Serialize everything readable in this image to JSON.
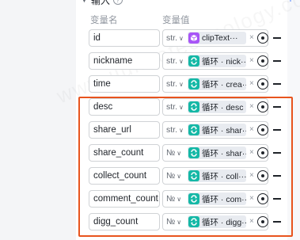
{
  "section": {
    "title": "输入",
    "help_glyph": "?",
    "add_glyph": "+"
  },
  "columns": {
    "name": "变量名",
    "value": "变量值"
  },
  "watermark": "www.jiuhaotechnology.com",
  "rows": [
    {
      "name": "id",
      "type": "str.",
      "source_icon": "cube-icon",
      "ref": "clipText···"
    },
    {
      "name": "nickname",
      "type": "str.",
      "source_icon": "loop-icon",
      "ref": "循环 · nick···"
    },
    {
      "name": "time",
      "type": "str.",
      "source_icon": "loop-icon",
      "ref": "循环 · crea···"
    },
    {
      "name": "desc",
      "type": "str.",
      "source_icon": "loop-icon",
      "ref": "循环 · desc"
    },
    {
      "name": "share_url",
      "type": "str.",
      "source_icon": "loop-icon",
      "ref": "循环 · shar···"
    },
    {
      "name": "share_count",
      "type": "№",
      "source_icon": "loop-icon",
      "ref": "循环 · shar···"
    },
    {
      "name": "collect_count",
      "type": "№",
      "source_icon": "loop-icon",
      "ref": "循环 · coll···"
    },
    {
      "name": "comment_count",
      "type": "№",
      "source_icon": "loop-icon",
      "ref": "循环 · com···"
    },
    {
      "name": "digg_count",
      "type": "№",
      "source_icon": "loop-icon",
      "ref": "循环 · digg···"
    }
  ],
  "colors": {
    "highlight": "#e8541e",
    "loop_icon": "#14b8a6",
    "cube_icon": "#a855f7",
    "accent": "#3370ff"
  }
}
